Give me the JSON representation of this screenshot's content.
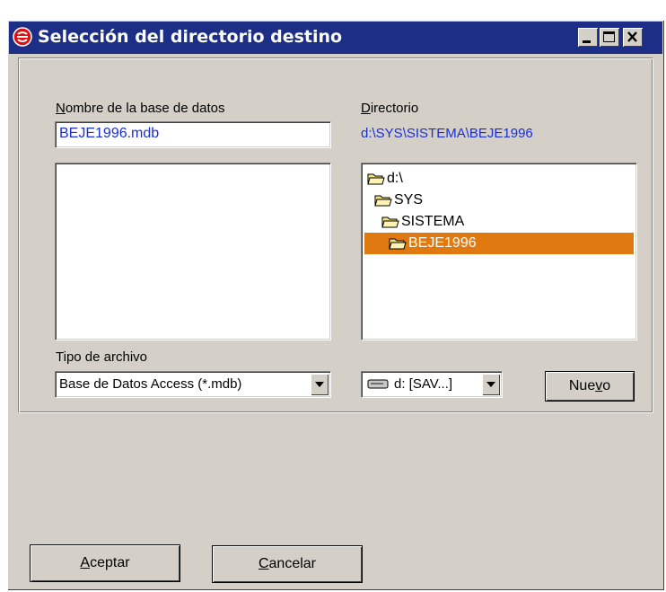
{
  "window": {
    "title": "Selección del directorio destino",
    "title_bar_color": "#1c2e86",
    "icons": {
      "app": "app-logo-icon",
      "minimize": "minimize-icon",
      "maximize": "maximize-icon",
      "close": "close-icon"
    }
  },
  "form": {
    "db_name_label": "Nombre de la base de datos",
    "db_name_value": "BEJE1996.mdb",
    "directory_label": "Directorio",
    "directory_path": "d:\\SYS\\SISTEMA\\BEJE1996",
    "tree": [
      {
        "label": "d:\\",
        "selected": false
      },
      {
        "label": "SYS",
        "selected": false
      },
      {
        "label": "SISTEMA",
        "selected": false
      },
      {
        "label": "BEJE1996",
        "selected": true
      }
    ],
    "file_type_label": "Tipo de archivo",
    "file_type_value": "Base de Datos Access (*.mdb)",
    "drive_value": "d: [SAV...]",
    "new_button": "Nuevo",
    "selection_color": "#e07a10"
  },
  "buttons": {
    "accept": "Aceptar",
    "cancel": "Cancelar"
  }
}
